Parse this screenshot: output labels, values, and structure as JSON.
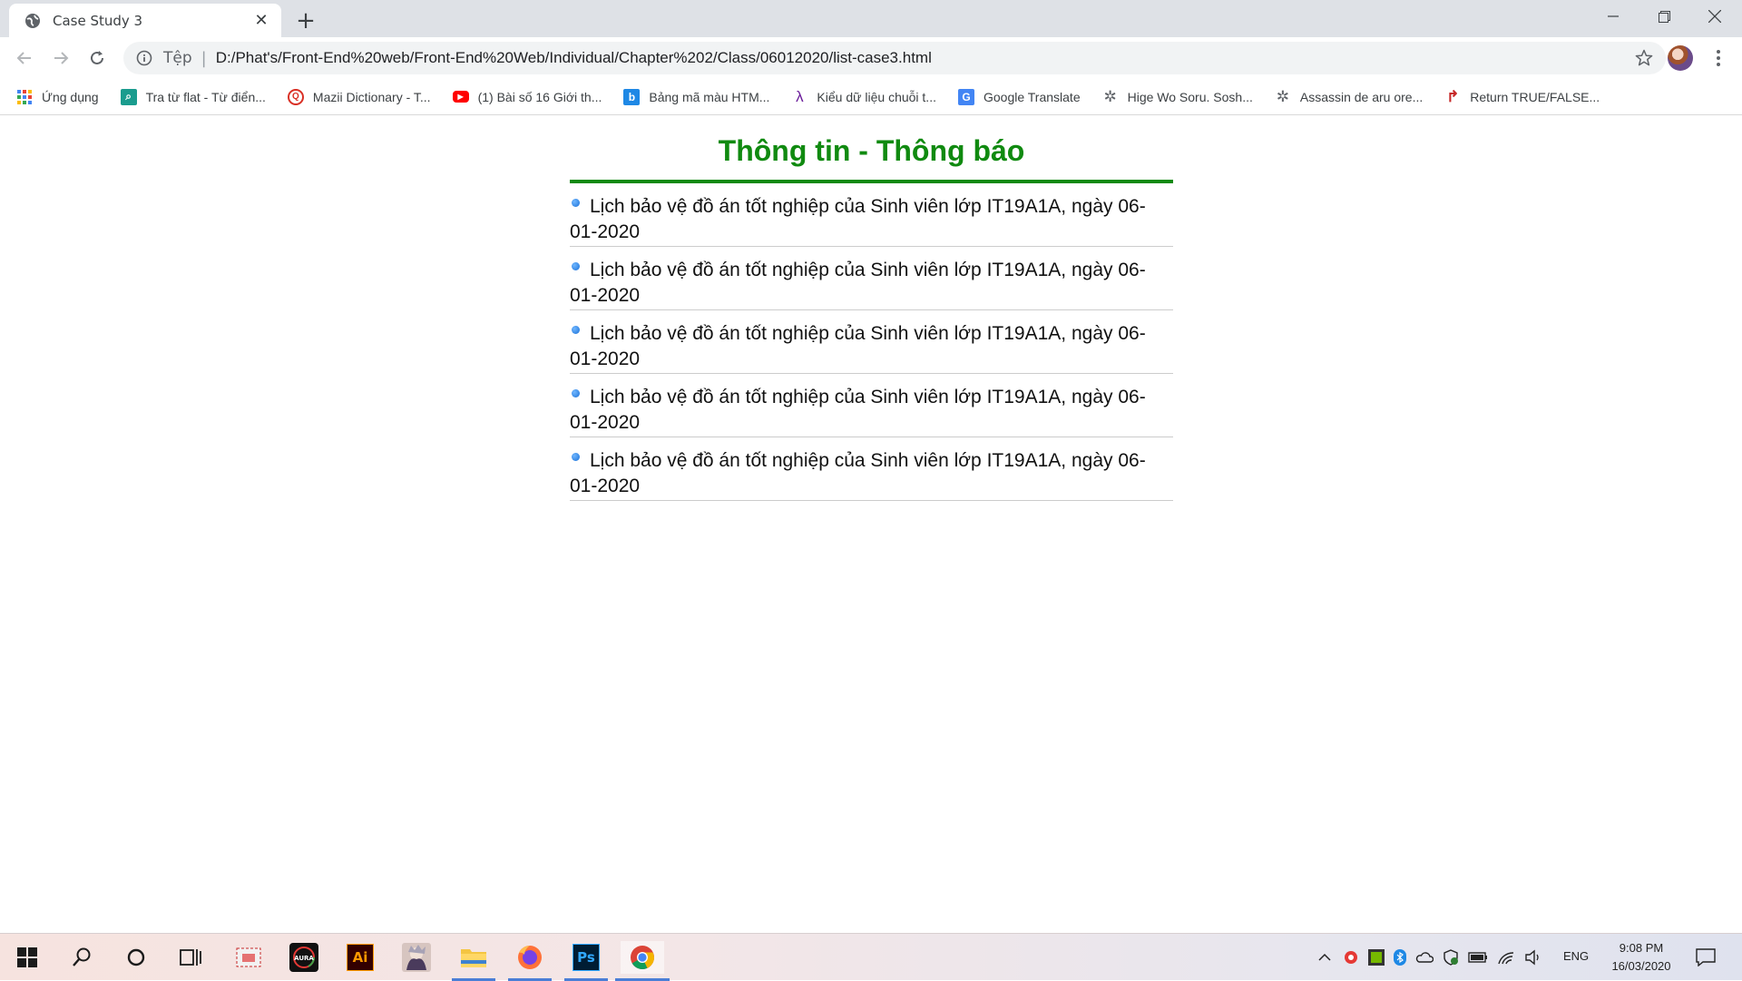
{
  "browser": {
    "tab_title": "Case Study 3",
    "new_tab_symbol": "+",
    "close_tab_symbol": "✕",
    "address": {
      "scheme_label": "Tệp",
      "url": "D:/Phat's/Front-End%20web/Front-End%20Web/Individual/Chapter%202/Class/06012020/list-case3.html"
    },
    "icons": [
      "back-icon",
      "forward-icon",
      "reload-icon",
      "info-icon",
      "star-icon",
      "profile-avatar",
      "menu-icon",
      "minimize-icon",
      "restore-icon",
      "close-icon"
    ]
  },
  "bookmarks": [
    {
      "label": "Ứng dụng",
      "icon": "apps-grid-icon",
      "color": "#4285f4"
    },
    {
      "label": "Tra từ flat - Từ điển...",
      "icon": "dictionary-icon",
      "color": "#1a9c8e"
    },
    {
      "label": "Mazii Dictionary - T...",
      "icon": "mazii-icon",
      "color": "#d93025"
    },
    {
      "label": "(1) Bài số 16 Giới th...",
      "icon": "youtube-icon",
      "color": "#ff0000"
    },
    {
      "label": "Bảng mã màu HTM...",
      "icon": "bing-icon",
      "color": "#1e88e5"
    },
    {
      "label": "Kiểu dữ liệu chuỗi t...",
      "icon": "lambda-icon",
      "color": "#6a1b9a"
    },
    {
      "label": "Google Translate",
      "icon": "translate-icon",
      "color": "#4285f4"
    },
    {
      "label": "Hige Wo Soru. Sosh...",
      "icon": "gear-icon",
      "color": "#5f6368"
    },
    {
      "label": "Assassin de aru ore...",
      "icon": "gear-icon",
      "color": "#5f6368"
    },
    {
      "label": "Return TRUE/FALSE...",
      "icon": "return-icon",
      "color": "#c62828"
    }
  ],
  "page": {
    "heading": "Thông tin - Thông báo",
    "heading_color": "#108a10",
    "items": [
      {
        "text": "Lịch bảo vệ đồ án tốt nghiệp của Sinh viên lớp IT19A1A, ngày 06-01-2020"
      },
      {
        "text": "Lịch bảo vệ đồ án tốt nghiệp của Sinh viên lớp IT19A1A, ngày 06-01-2020"
      },
      {
        "text": "Lịch bảo vệ đồ án tốt nghiệp của Sinh viên lớp IT19A1A, ngày 06-01-2020"
      },
      {
        "text": "Lịch bảo vệ đồ án tốt nghiệp của Sinh viên lớp IT19A1A, ngày 06-01-2020"
      },
      {
        "text": "Lịch bảo vệ đồ án tốt nghiệp của Sinh viên lớp IT19A1A, ngày 06-01-2020"
      }
    ]
  },
  "taskbar": {
    "apps": [
      "start-icon",
      "search-icon",
      "cortana-icon",
      "task-view-icon",
      "snip-icon",
      "aura-icon",
      "illustrator-icon",
      "game-icon",
      "file-explorer-icon",
      "firefox-icon",
      "photoshop-icon",
      "chrome-icon"
    ],
    "illustrator_label": "Ai",
    "photoshop_label": "Ps",
    "language": "ENG",
    "time": "9:08 PM",
    "date": "16/03/2020"
  }
}
